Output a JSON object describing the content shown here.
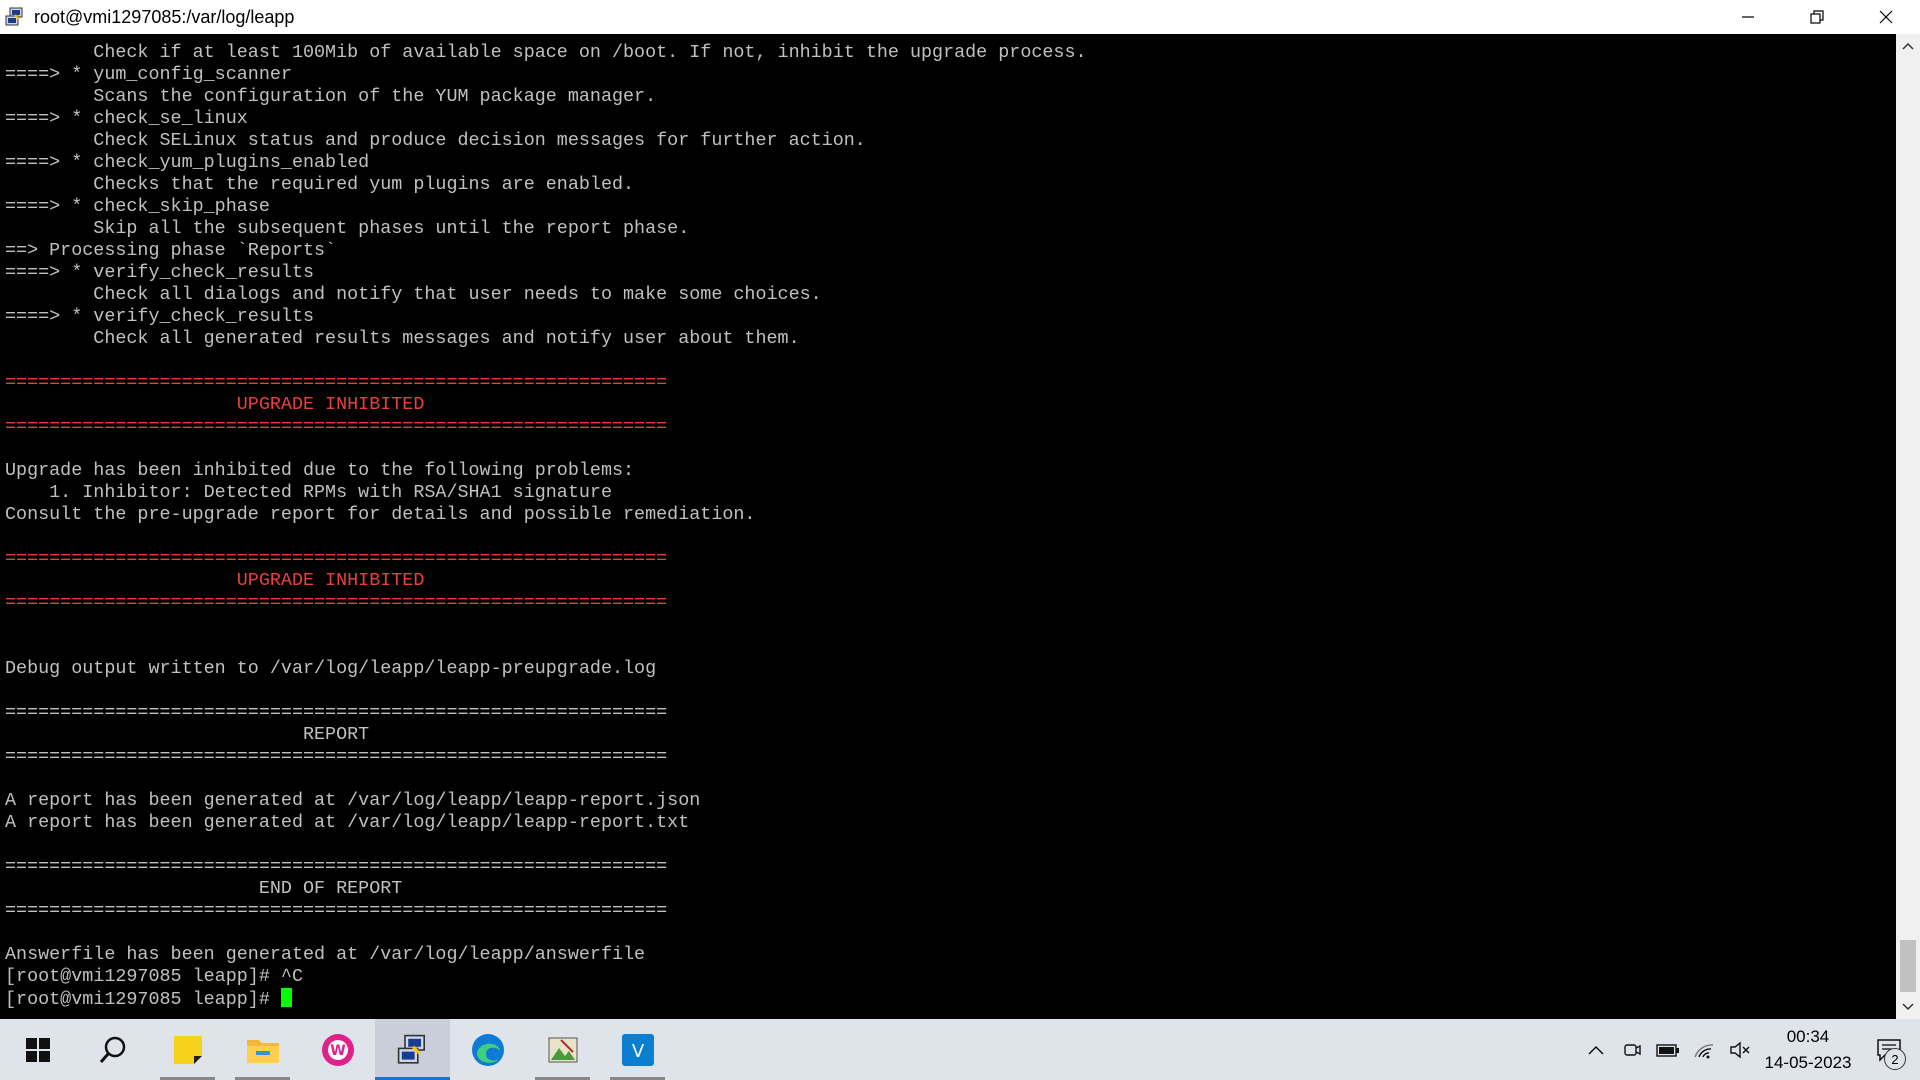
{
  "window": {
    "title": "root@vmi1297085:/var/log/leapp"
  },
  "terminal": {
    "lines": [
      {
        "text": "        Check if at least 100Mib of available space on /boot. If not, inhibit the upgrade process.",
        "color": "default"
      },
      {
        "text": "====> * yum_config_scanner",
        "color": "default"
      },
      {
        "text": "        Scans the configuration of the YUM package manager.",
        "color": "default"
      },
      {
        "text": "====> * check_se_linux",
        "color": "default"
      },
      {
        "text": "        Check SELinux status and produce decision messages for further action.",
        "color": "default"
      },
      {
        "text": "====> * check_yum_plugins_enabled",
        "color": "default"
      },
      {
        "text": "        Checks that the required yum plugins are enabled.",
        "color": "default"
      },
      {
        "text": "====> * check_skip_phase",
        "color": "default"
      },
      {
        "text": "        Skip all the subsequent phases until the report phase.",
        "color": "default"
      },
      {
        "text": "==> Processing phase `Reports`",
        "color": "default"
      },
      {
        "text": "====> * verify_check_results",
        "color": "default"
      },
      {
        "text": "        Check all dialogs and notify that user needs to make some choices.",
        "color": "default"
      },
      {
        "text": "====> * verify_check_results",
        "color": "default"
      },
      {
        "text": "        Check all generated results messages and notify user about them.",
        "color": "default"
      },
      {
        "text": "",
        "color": "default"
      },
      {
        "text": "============================================================",
        "color": "red"
      },
      {
        "text": "                     UPGRADE INHIBITED",
        "color": "red"
      },
      {
        "text": "============================================================",
        "color": "red"
      },
      {
        "text": "",
        "color": "default"
      },
      {
        "text": "Upgrade has been inhibited due to the following problems:",
        "color": "default"
      },
      {
        "text": "    1. Inhibitor: Detected RPMs with RSA/SHA1 signature",
        "color": "default"
      },
      {
        "text": "Consult the pre-upgrade report for details and possible remediation.",
        "color": "default"
      },
      {
        "text": "",
        "color": "default"
      },
      {
        "text": "============================================================",
        "color": "red"
      },
      {
        "text": "                     UPGRADE INHIBITED",
        "color": "red"
      },
      {
        "text": "============================================================",
        "color": "red"
      },
      {
        "text": "",
        "color": "default"
      },
      {
        "text": "",
        "color": "default"
      },
      {
        "text": "Debug output written to /var/log/leapp/leapp-preupgrade.log",
        "color": "default"
      },
      {
        "text": "",
        "color": "default"
      },
      {
        "text": "============================================================",
        "color": "default"
      },
      {
        "text": "                           REPORT",
        "color": "default"
      },
      {
        "text": "============================================================",
        "color": "default"
      },
      {
        "text": "",
        "color": "default"
      },
      {
        "text": "A report has been generated at /var/log/leapp/leapp-report.json",
        "color": "default"
      },
      {
        "text": "A report has been generated at /var/log/leapp/leapp-report.txt",
        "color": "default"
      },
      {
        "text": "",
        "color": "default"
      },
      {
        "text": "============================================================",
        "color": "default"
      },
      {
        "text": "                       END OF REPORT",
        "color": "default"
      },
      {
        "text": "============================================================",
        "color": "default"
      },
      {
        "text": "",
        "color": "default"
      },
      {
        "text": "Answerfile has been generated at /var/log/leapp/answerfile",
        "color": "default"
      },
      {
        "text": "[root@vmi1297085 leapp]# ^C",
        "color": "default"
      },
      {
        "text": "[root@vmi1297085 leapp]# ",
        "color": "default",
        "cursor": true
      }
    ]
  },
  "taskbar": {
    "apps": [
      {
        "icon": "windows-start-icon",
        "active": false,
        "running": false
      },
      {
        "icon": "search-icon",
        "active": false,
        "running": false
      },
      {
        "icon": "sticky-notes-icon",
        "active": false,
        "running": true
      },
      {
        "icon": "file-explorer-icon",
        "active": false,
        "running": true
      },
      {
        "icon": "winamp-icon",
        "active": false,
        "running": false
      },
      {
        "icon": "putty-icon",
        "active": true,
        "running": true
      },
      {
        "icon": "edge-browser-icon",
        "active": false,
        "running": false
      },
      {
        "icon": "image-viewer-icon",
        "active": false,
        "running": true
      },
      {
        "icon": "vscode-icon",
        "active": false,
        "running": true
      }
    ],
    "clock": {
      "time": "00:34",
      "date": "14-05-2023"
    },
    "notification_count": "2"
  },
  "colors": {
    "terminal_bg": "#000000",
    "terminal_fg": "#c0c0c0",
    "inhibit_red": "#e8413b",
    "cursor_green": "#00ff00",
    "taskbar_bg": "#dfe3ea"
  }
}
